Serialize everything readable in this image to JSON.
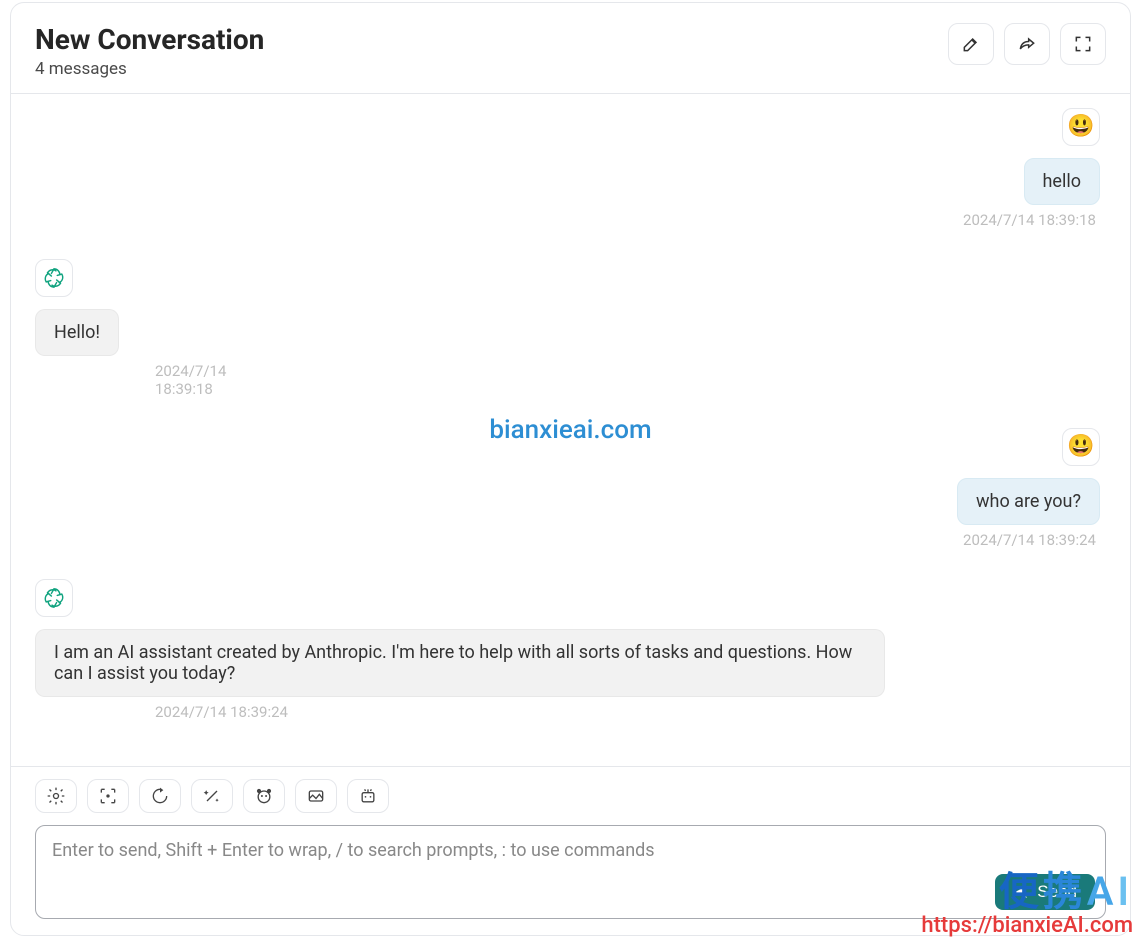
{
  "header": {
    "title": "New Conversation",
    "subtitle": "4 messages"
  },
  "messages": [
    {
      "role": "user",
      "avatar_emoji": "😃",
      "text": "hello",
      "timestamp": "2024/7/14 18:39:18"
    },
    {
      "role": "assistant",
      "text": "Hello!",
      "timestamp": "2024/7/14 18:39:18"
    },
    {
      "role": "user",
      "avatar_emoji": "😃",
      "text": "who are you?",
      "timestamp": "2024/7/14 18:39:24"
    },
    {
      "role": "assistant",
      "text": "I am an AI assistant created by Anthropic. I'm here to help with all sorts of tasks and questions. How can I assist you today?",
      "timestamp": "2024/7/14 18:39:24"
    }
  ],
  "watermark": {
    "center": "bianxieai.com",
    "bottom_zh_chars": [
      "便",
      "携",
      "A",
      "I"
    ],
    "bottom_url": "https://bianxieAI.com"
  },
  "composer": {
    "placeholder": "Enter to send, Shift + Enter to wrap, / to search prompts, : to use commands",
    "send_label": "Send"
  }
}
